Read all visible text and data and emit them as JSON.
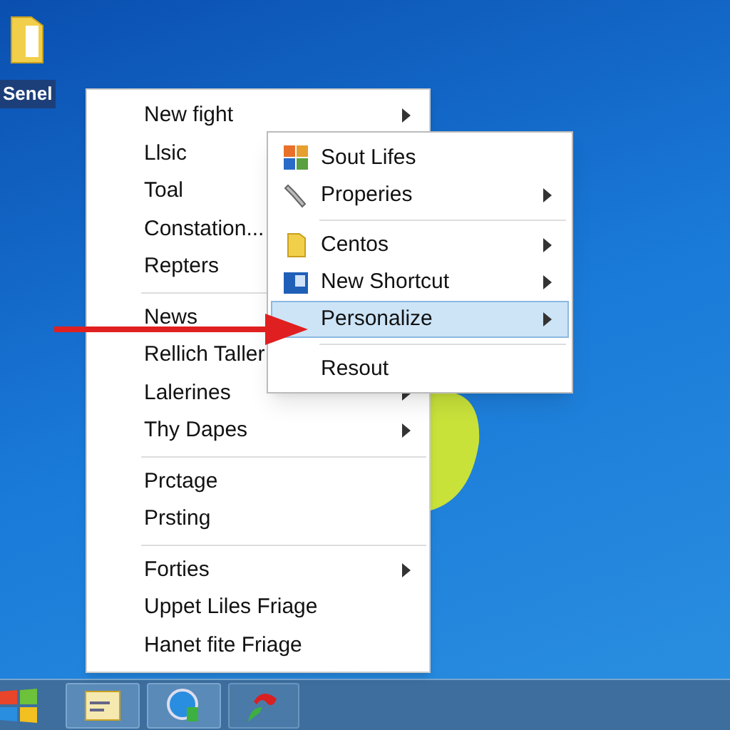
{
  "desktop_icons": [
    {
      "label": "Senel"
    }
  ],
  "context_menu": {
    "items": [
      {
        "kind": "item",
        "label": "New fight",
        "has_submenu": true
      },
      {
        "kind": "item",
        "label": "Llsic"
      },
      {
        "kind": "item",
        "label": "Toal"
      },
      {
        "kind": "item",
        "label": "Constation..."
      },
      {
        "kind": "item",
        "label": "Repters"
      },
      {
        "kind": "separator"
      },
      {
        "kind": "item",
        "label": "News"
      },
      {
        "kind": "item",
        "label": "Rellich Taller"
      },
      {
        "kind": "item",
        "label": "Lalerines",
        "has_submenu": true
      },
      {
        "kind": "item",
        "label": "Thy Dapes",
        "has_submenu": true
      },
      {
        "kind": "separator"
      },
      {
        "kind": "item",
        "label": "Prctage",
        "has_submenu": false
      },
      {
        "kind": "item",
        "label": "Prsting",
        "has_submenu": false
      },
      {
        "kind": "separator"
      },
      {
        "kind": "item",
        "label": "Forties",
        "has_submenu": true
      },
      {
        "kind": "item",
        "label": "Uppet Liles Friage",
        "has_submenu": false
      },
      {
        "kind": "item",
        "label": "Hanet fite Friage",
        "has_submenu": false
      }
    ]
  },
  "submenu": {
    "items": [
      {
        "kind": "item",
        "label": "Sout Lifes",
        "has_submenu": false,
        "selected": false
      },
      {
        "kind": "item",
        "label": "Properies",
        "has_submenu": true,
        "selected": false
      },
      {
        "kind": "separator"
      },
      {
        "kind": "item",
        "label": "Centos",
        "has_submenu": true,
        "selected": false
      },
      {
        "kind": "item",
        "label": "New Shortcut",
        "has_submenu": true,
        "selected": false
      },
      {
        "kind": "item",
        "label": "Personalize",
        "has_submenu": true,
        "selected": true
      },
      {
        "kind": "separator"
      },
      {
        "kind": "item",
        "label": "Resout",
        "has_submenu": false,
        "selected": false
      }
    ]
  }
}
